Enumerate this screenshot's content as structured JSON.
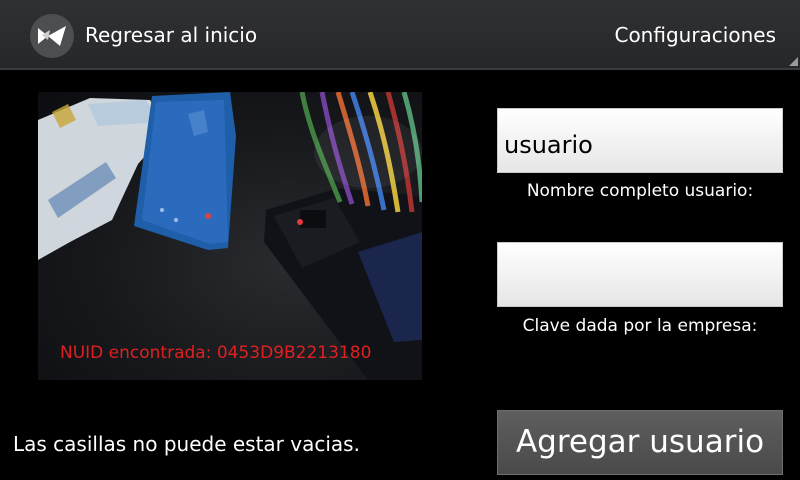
{
  "colors": {
    "background": "#000000",
    "action_bar": "#2b2c2e",
    "nuid_text": "#e02020",
    "input_background": "#f2f2f2",
    "button_background": "#555555"
  },
  "action_bar": {
    "app_icon": "kivy-logo-icon",
    "previous_label": "Regresar al inicio",
    "settings_label": "Configuraciones",
    "settings_indicator": "corner-triangle-icon"
  },
  "camera": {
    "overlay_text": "NUID encontrada: 0453D9B2213180"
  },
  "form": {
    "username": {
      "value": "usuario",
      "label": "Nombre completo usuario:"
    },
    "company_key": {
      "value": "",
      "label": "Clave dada por la empresa:"
    }
  },
  "footer": {
    "status_message": "Las casillas no puede estar vacias.",
    "add_user_label": "Agregar usuario"
  }
}
